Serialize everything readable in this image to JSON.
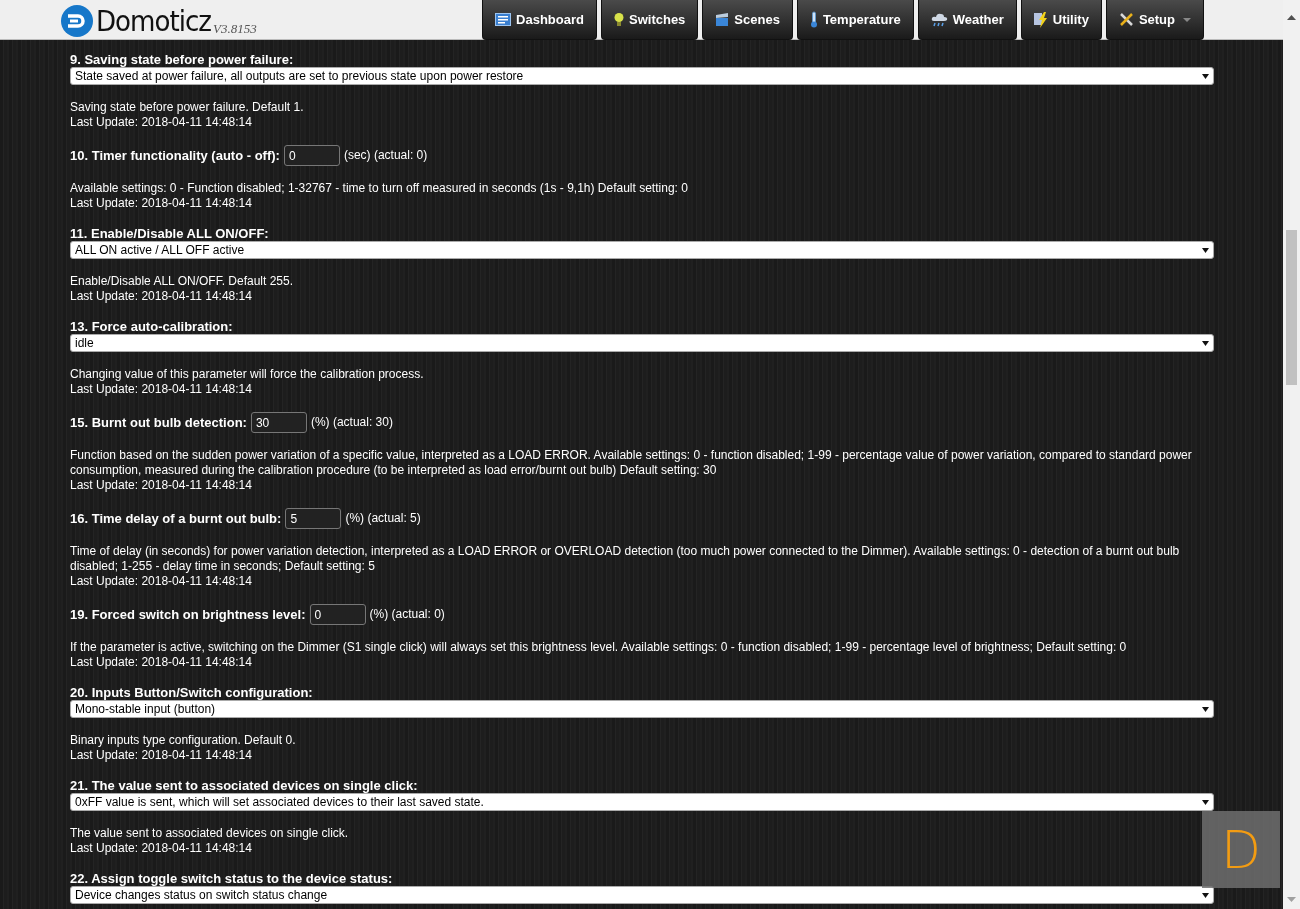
{
  "header": {
    "logo_text": "Domoticz",
    "version": "V3.8153"
  },
  "nav": [
    {
      "label": "Dashboard",
      "kind": "link"
    },
    {
      "label": "Switches",
      "kind": "link"
    },
    {
      "label": "Scenes",
      "kind": "link"
    },
    {
      "label": "Temperature",
      "kind": "link"
    },
    {
      "label": "Weather",
      "kind": "link"
    },
    {
      "label": "Utility",
      "kind": "link"
    },
    {
      "label": "Setup",
      "kind": "menu"
    }
  ],
  "parameters": [
    {
      "kind": "select",
      "title": "9. Saving state before power failure:",
      "value": "State saved at power failure, all outputs are set to previous state upon power restore",
      "description": "Saving state before power failure. Default 1.",
      "last_update": "Last Update: 2018-04-11 14:48:14"
    },
    {
      "kind": "number",
      "title": "10. Timer functionality (auto - off):",
      "value": "0",
      "suffix": "(sec) (actual: 0)",
      "description": "Available settings: 0 - Function disabled; 1-32767 - time to turn off measured in seconds (1s - 9,1h) Default setting: 0",
      "last_update": "Last Update: 2018-04-11 14:48:14"
    },
    {
      "kind": "select",
      "title": "11. Enable/Disable ALL ON/OFF:",
      "value": "ALL ON active / ALL OFF active",
      "description": "Enable/Disable ALL ON/OFF. Default 255.",
      "last_update": "Last Update: 2018-04-11 14:48:14"
    },
    {
      "kind": "select",
      "title": "13. Force auto-calibration:",
      "value": "idle",
      "description": "Changing value of this parameter will force the calibration process.",
      "last_update": "Last Update: 2018-04-11 14:48:14"
    },
    {
      "kind": "number",
      "title": "15. Burnt out bulb detection:",
      "value": "30",
      "suffix": "(%) (actual: 30)",
      "description": "Function based on the sudden power variation of a specific value, interpreted as a LOAD ERROR. Available settings: 0 - function disabled; 1-99 - percentage value of power variation, compared to standard power consumption, measured during the calibration procedure (to be interpreted as load error/burnt out bulb) Default setting: 30",
      "last_update": "Last Update: 2018-04-11 14:48:14"
    },
    {
      "kind": "number",
      "title": "16. Time delay of a burnt out bulb:",
      "value": "5",
      "suffix": "(%) (actual: 5)",
      "description": "Time of delay (in seconds) for power variation detection, interpreted as a LOAD ERROR or OVERLOAD detection (too much power connected to the Dimmer). Available settings: 0 - detection of a burnt out bulb disabled; 1-255 - delay time in seconds; Default setting: 5",
      "last_update": "Last Update: 2018-04-11 14:48:14"
    },
    {
      "kind": "number",
      "title": "19. Forced switch on brightness level:",
      "value": "0",
      "suffix": "(%) (actual: 0)",
      "description": "If the parameter is active, switching on the Dimmer (S1 single click) will always set this brightness level. Available settings: 0 - function disabled; 1-99 - percentage level of brightness; Default setting: 0",
      "last_update": "Last Update: 2018-04-11 14:48:14"
    },
    {
      "kind": "select",
      "title": "20. Inputs Button/Switch configuration:",
      "value": "Mono-stable input (button)",
      "description": "Binary inputs type configuration. Default 0.",
      "last_update": "Last Update: 2018-04-11 14:48:14"
    },
    {
      "kind": "select",
      "title": "21. The value sent to associated devices on single click:",
      "value": "0xFF value is sent, which will set associated devices to their last saved state.",
      "description": "The value sent to associated devices on single click.",
      "last_update": "Last Update: 2018-04-11 14:48:14"
    },
    {
      "kind": "select",
      "title": "22. Assign toggle switch status to the device status:",
      "value": "Device changes status on switch status change"
    }
  ],
  "floating_button": {
    "label": "D"
  }
}
